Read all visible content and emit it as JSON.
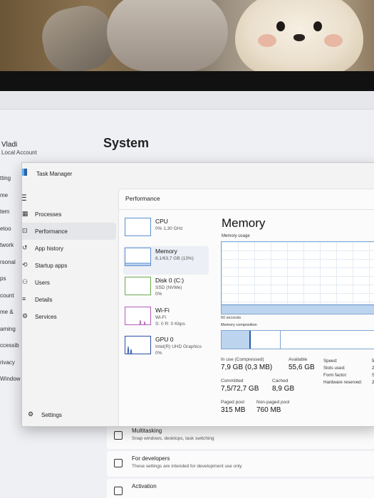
{
  "settings": {
    "user_name": "Vladi",
    "user_account": "Local Account",
    "title": "System",
    "left_nav": [
      "tting",
      "me",
      "tem",
      "etoo",
      "twork",
      "rsonal",
      "ps",
      "count",
      "me &",
      "aming",
      "ccessib",
      "rivacy",
      "Window"
    ],
    "rows": [
      {
        "title": "Multitasking",
        "desc": "Snap windows, desktops, task switching"
      },
      {
        "title": "For developers",
        "desc": "These settings are intended for development use only"
      },
      {
        "title": "Activation",
        "desc": ""
      }
    ]
  },
  "taskmanager": {
    "title": "Task Manager",
    "nav": [
      {
        "label": "Processes",
        "icon": "processes-icon"
      },
      {
        "label": "Performance",
        "icon": "performance-icon"
      },
      {
        "label": "App history",
        "icon": "history-icon"
      },
      {
        "label": "Startup apps",
        "icon": "startup-icon"
      },
      {
        "label": "Users",
        "icon": "users-icon"
      },
      {
        "label": "Details",
        "icon": "details-icon"
      },
      {
        "label": "Services",
        "icon": "services-icon"
      }
    ],
    "settings_label": "Settings",
    "active_nav": "Performance",
    "page_title": "Performance",
    "resources": [
      {
        "name": "CPU",
        "sub1": "0% 1,30 GHz",
        "sub2": ""
      },
      {
        "name": "Memory",
        "sub1": "8,1/63,7 GB (13%)",
        "sub2": ""
      },
      {
        "name": "Disk 0 (C:)",
        "sub1": "SSD (NVMe)",
        "sub2": "0%"
      },
      {
        "name": "Wi-Fi",
        "sub1": "Wi-Fi",
        "sub2": "S: 0 R: 0 Kbps"
      },
      {
        "name": "GPU 0",
        "sub1": "Intel(R) UHD Graphics",
        "sub2": "0%"
      }
    ],
    "memory": {
      "header": "Memory",
      "usage_label": "Memory usage",
      "usage_fraction": 0.13,
      "seconds_label": "60 seconds",
      "composition_label": "Memory composition",
      "in_use_label": "In use (Compressed)",
      "in_use_value": "7,9 GB (0,3 MB)",
      "available_label": "Available",
      "available_value": "55,6 GB",
      "committed_label": "Committed",
      "committed_value": "7,5/72,7 GB",
      "cached_label": "Cached",
      "cached_value": "8,9 GB",
      "paged_label": "Paged pool",
      "paged_value": "315 MB",
      "nonpaged_label": "Non-paged pool",
      "nonpaged_value": "760 MB",
      "speed_label": "Speed:",
      "speed_value": "5",
      "slots_label": "Slots used:",
      "slots_value": "2",
      "form_label": "Form factor:",
      "form_value": "S",
      "hw_label": "Hardware reserved:",
      "hw_value": "2"
    }
  },
  "colors": {
    "accent": "#0a5fc2",
    "memory_line": "#5b8bc9",
    "memory_fill": "#bdd4ee"
  }
}
